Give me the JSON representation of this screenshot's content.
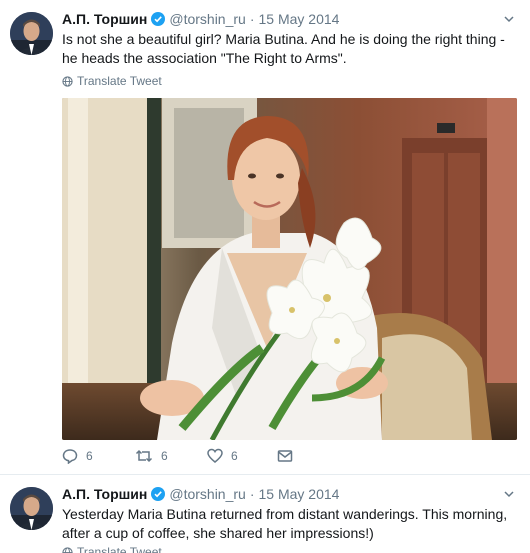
{
  "tweets": [
    {
      "author_name": "А.П. Торшин",
      "handle": "@torshin_ru",
      "separator": "·",
      "date": "15 May 2014",
      "text": "Is not she a beautiful girl? Maria Butina. And he is doing the right thing - he heads the association \"The Right to Arms\".",
      "translate_label": "Translate Tweet",
      "replies": "6",
      "retweets": "6",
      "likes": "6"
    },
    {
      "author_name": "А.П. Торшин",
      "handle": "@torshin_ru",
      "separator": "·",
      "date": "15 May 2014",
      "text": "Yesterday Maria Butina returned from distant wanderings. This morning, after a cup of coffee, she shared her impressions!)",
      "translate_label": "Translate Tweet"
    }
  ],
  "colors": {
    "text_primary": "#14171a",
    "text_secondary": "#657786",
    "verified_blue": "#1da1f2",
    "divider": "#e6ecf0"
  },
  "icons": [
    "verified-icon",
    "chevron-down-icon",
    "globe-icon",
    "reply-icon",
    "retweet-icon",
    "heart-icon",
    "envelope-icon"
  ]
}
